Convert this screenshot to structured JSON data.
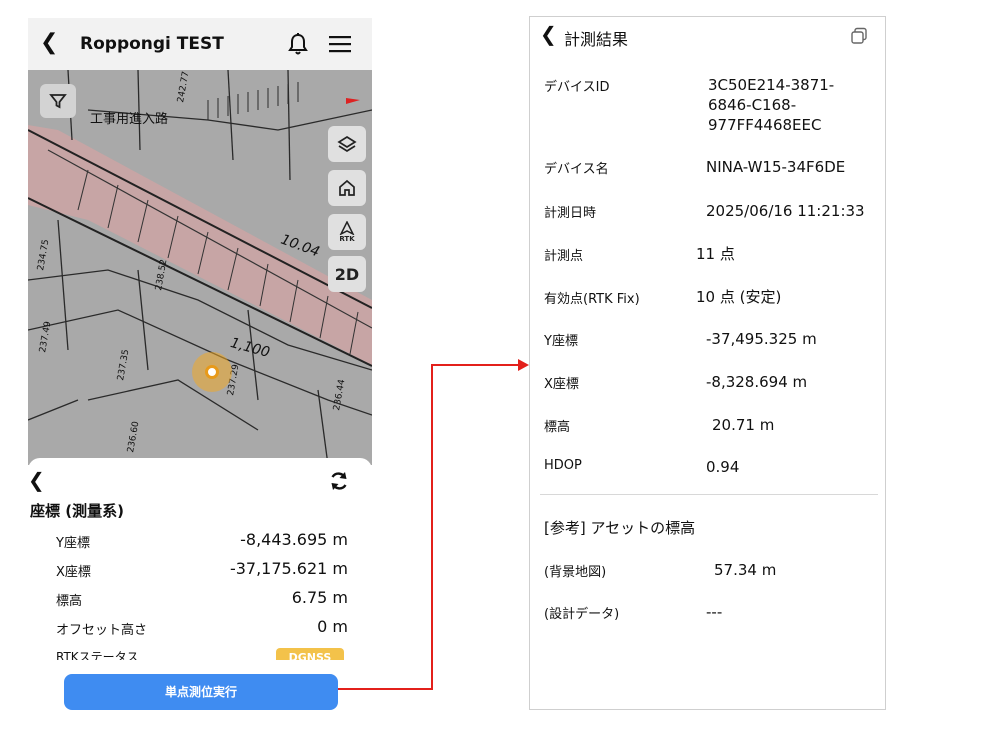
{
  "left_screen": {
    "header": {
      "title": "Roppongi TEST"
    },
    "map": {
      "label_road": "工事用進入路",
      "labels": [
        "10.04",
        "1,100",
        "238.52",
        "237.35",
        "237.29",
        "236.44",
        "236.60",
        "242.77",
        "237.49",
        "234.75"
      ],
      "buttons": {
        "mode_2d": "2D",
        "rtk_label": "RTK"
      }
    },
    "sheet": {
      "title": "座標 (測量系)",
      "rows": [
        {
          "label": "Y座標",
          "value": "-8,443.695 m"
        },
        {
          "label": "X座標",
          "value": "-37,175.621 m"
        },
        {
          "label": "標高",
          "value": "6.75 m"
        },
        {
          "label": "オフセット高さ",
          "value": "0 m"
        }
      ],
      "rtk_status_label": "RTKステータス",
      "rtk_status_value": "DGNSS"
    },
    "execute_button": "単点測位実行"
  },
  "right_screen": {
    "title": "計測結果",
    "rows": [
      {
        "label": "デバイスID",
        "value_lines": [
          "3C50E214-3871-",
          "6846-C168-",
          "977FF4468EEC"
        ]
      },
      {
        "label": "デバイス名",
        "value": "NINA-W15-34F6DE"
      },
      {
        "label": "計測日時",
        "value": "2025/06/16 11:21:33"
      },
      {
        "label": "計測点",
        "value": "11 点"
      },
      {
        "label": "有効点(RTK Fix)",
        "value": "10 点 (安定)"
      },
      {
        "label": "Y座標",
        "value": "-37,495.325 m"
      },
      {
        "label": "X座標",
        "value": "-8,328.694 m"
      },
      {
        "label": "標高",
        "value": "20.71 m"
      },
      {
        "label": "HDOP",
        "value": "0.94"
      }
    ],
    "section_title": "[参考] アセットの標高",
    "ref_rows": [
      {
        "label": "(背景地図)",
        "value": "57.34 m"
      },
      {
        "label": "(設計データ)",
        "value": "---"
      }
    ]
  },
  "colors": {
    "accent_blue": "#3f8cf1",
    "connector_red": "#e3201b",
    "badge_yellow": "#f3c24a",
    "location_orange": "#e79a1a"
  }
}
